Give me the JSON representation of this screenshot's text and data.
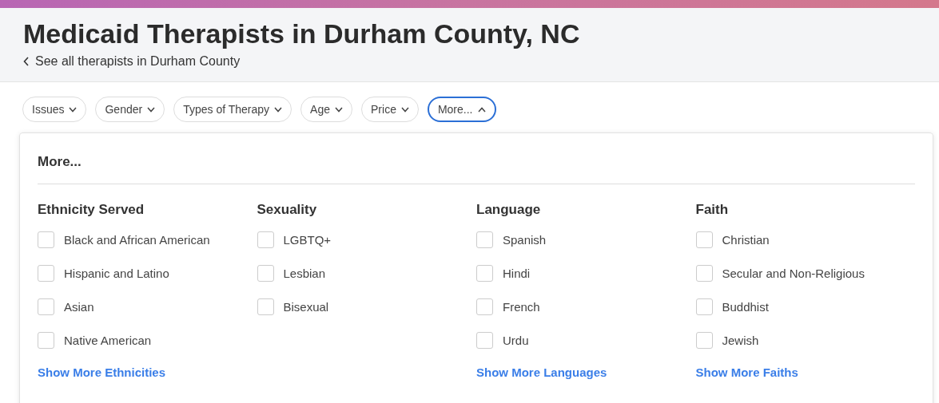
{
  "header": {
    "title": "Medicaid Therapists in Durham County, NC",
    "back_link": "See all therapists in Durham County"
  },
  "filters": [
    {
      "label": "Issues",
      "selected": false
    },
    {
      "label": "Gender",
      "selected": false
    },
    {
      "label": "Types of Therapy",
      "selected": false
    },
    {
      "label": "Age",
      "selected": false
    },
    {
      "label": "Price",
      "selected": false
    },
    {
      "label": "More...",
      "selected": true
    }
  ],
  "panel": {
    "title": "More...",
    "groups": [
      {
        "heading": "Ethnicity Served",
        "options": [
          {
            "label": "Black and African American",
            "checked": false
          },
          {
            "label": "Hispanic and Latino",
            "checked": false
          },
          {
            "label": "Asian",
            "checked": false
          },
          {
            "label": "Native American",
            "checked": false
          }
        ],
        "show_more": "Show More Ethnicities"
      },
      {
        "heading": "Sexuality",
        "options": [
          {
            "label": "LGBTQ+",
            "checked": false
          },
          {
            "label": "Lesbian",
            "checked": false
          },
          {
            "label": "Bisexual",
            "checked": false
          }
        ]
      },
      {
        "heading": "Language",
        "options": [
          {
            "label": "Spanish",
            "checked": false
          },
          {
            "label": "Hindi",
            "checked": false
          },
          {
            "label": "French",
            "checked": false
          },
          {
            "label": "Urdu",
            "checked": false
          }
        ],
        "show_more": "Show More Languages"
      },
      {
        "heading": "Faith",
        "options": [
          {
            "label": "Christian",
            "checked": false
          },
          {
            "label": "Secular and Non-Religious",
            "checked": false
          },
          {
            "label": "Buddhist",
            "checked": false
          },
          {
            "label": "Jewish",
            "checked": false
          }
        ],
        "show_more": "Show More Faiths"
      }
    ]
  }
}
